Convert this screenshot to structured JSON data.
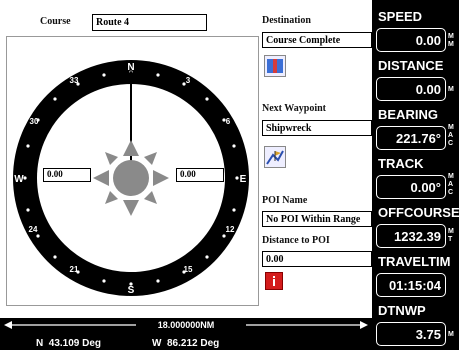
{
  "course": {
    "label": "Course",
    "value": "Route 4"
  },
  "destination": {
    "label": "Destination",
    "value": "Course Complete"
  },
  "next_waypoint": {
    "label": "Next Waypoint",
    "value": "Shipwreck"
  },
  "poi": {
    "name_label": "POI Name",
    "name_value": "No POI Within Range",
    "distance_label": "Distance to POI",
    "distance_value": "0.00"
  },
  "compass": {
    "west_value": "0.00",
    "east_value": "0.00",
    "cardinals": {
      "n": "N",
      "s": "S",
      "e": "E",
      "w": "W"
    },
    "degrees": {
      "d3": "3",
      "d6": "6",
      "d12": "12",
      "d15": "15",
      "d21": "21",
      "d24": "24",
      "d30": "30",
      "d33": "33"
    }
  },
  "scale": {
    "value": "18.000000NM"
  },
  "coords": {
    "lat": "N  43.109 Deg",
    "lon": "W  86.212 Deg"
  },
  "stats": {
    "speed": {
      "label": "SPEED",
      "value": "0.00",
      "unit": "M M"
    },
    "distance": {
      "label": "DISTANCE",
      "value": "0.00",
      "unit": "M"
    },
    "bearing": {
      "label": "BEARING",
      "value": "221.76°",
      "unit": "M A C"
    },
    "track": {
      "label": "TRACK",
      "value": "0.00°",
      "unit": "M A C"
    },
    "offcourse": {
      "label": "OFFCOURSE",
      "value": "1232.39",
      "unit": "M T"
    },
    "traveltime": {
      "label": "TRAVELTIM",
      "value": "01:15:04",
      "unit": ""
    },
    "dtnwp": {
      "label": "DTNWP",
      "value": "3.75",
      "unit": "M"
    }
  }
}
